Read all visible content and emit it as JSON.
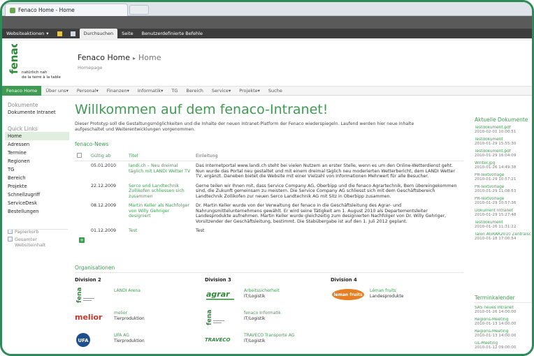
{
  "browser": {
    "tab_title": "Fenaco Home - Home"
  },
  "ribbon": {
    "site_actions": "Websiteaktionen",
    "tabs": [
      "Durchsuchen",
      "Seite",
      "Benutzerdefinierte Befehle"
    ]
  },
  "header": {
    "logo_text": "fenaco",
    "tagline_1": "natürlich nah",
    "tagline_2": "de la terre à la table",
    "site_title": "Fenaco Home",
    "breadcrumb_current": "Home",
    "subtitle": "Homepage"
  },
  "topnav": {
    "items": [
      {
        "label": "Fenaco Home",
        "selected": true,
        "dropdown": false
      },
      {
        "label": "Über uns",
        "dropdown": true
      },
      {
        "label": "Personal",
        "dropdown": true
      },
      {
        "label": "Finanzen",
        "dropdown": true
      },
      {
        "label": "Informatik",
        "dropdown": true
      },
      {
        "label": "TG",
        "dropdown": false
      },
      {
        "label": "Bereich",
        "dropdown": false
      },
      {
        "label": "Service",
        "dropdown": true
      },
      {
        "label": "Projekte",
        "dropdown": true
      },
      {
        "label": "Suche",
        "dropdown": false
      }
    ]
  },
  "quicklaunch": {
    "docs_header": "Dokumente",
    "docs_items": [
      "Dokumente Intranet"
    ],
    "links_header": "Quick Links",
    "links_items": [
      "Home",
      "Adressen",
      "Termine",
      "Regionen",
      "TG",
      "Bereich",
      "Projekte",
      "Schnellzugriff",
      "ServiceDesk",
      "Bestellungen"
    ],
    "selected": "Home",
    "recycle_bin": "Papierkorb",
    "all_content": "Gesamter Websiteinhalt"
  },
  "main": {
    "welcome": "Willkommen auf dem fenaco-Intranet!",
    "intro": "Dieser Prototyp soll die Gestaltungsmöglichkeiten und die Inhalte der neuen Intranet-Platform der Fenaco wiederspiegeln. Laufend werden hier neue Inhalte aufgeschaltet und Weiterentwicklungen vorgenommen.",
    "news_title": "fenaco-News",
    "news_columns": [
      "Gültig ab",
      "Titel",
      "Einleitung"
    ],
    "news_rows": [
      {
        "date": "05.01.2010",
        "title": "landi.ch – Neu dreimal täglich mit LANDI Wetter TV",
        "intro": "Das Internetportal www.landi.ch steht bei vielen Nutzern an erster Stelle, wenn es um den Online-Wetterdienst geht. Nun wurde das Portal neu gestaltet und mit einem dreimal täglich neu moderierten Wetterbericht, dem LANDI Wetter TV, ergänzt. Daneben bietet die Website mit einer Vielzahl von Informationen Mehrwert für alle Besucher."
      },
      {
        "date": "22.12.2009",
        "title": "Serco und Landtechnik Zollikofen schliessen sich zusammen",
        "intro": "Gerne teilen wir Ihnen mit, dass Service Company AG, Oberbipp und die fenaco Agrartechnik, Bern übereingekommen sind, die Zukunft gemeinsam zu meistern. Die Service Company AG schliesst sich mit dem Geschäftsbereich Landtechnik Zollikofen zur neuen Serco Landtechnik AG mit Sitz in Oberbipp zusammen."
      },
      {
        "date": "08.12.2009",
        "title": "Martin Keller als Nachfolger von Willy Gehriger designiert",
        "intro": "Dr. Martin Keller wurde von der Verwaltung der fenaco in die Geschäftsleitung des Agrar- und Nahrungsmittelunternehmens gewählt. Er wird seine Tätigkeit am 1. August 2010 als Departementsleiter Landesprodukte aufnehmen. Martin Keller wurde gleichzeitig zum designierten Nachfolger von Dr. Willy Gehriger, Vorsitzender der Geschäftsleitung, bestimmt. Die Stabübergabe ist auf den 1. Juli 2012 geplant."
      },
      {
        "date": "01.12.2009",
        "title": "Test",
        "intro": "Test"
      }
    ]
  },
  "orgs": {
    "title": "Organisationen",
    "divisions": [
      {
        "name": "Division 2",
        "items": [
          {
            "logo": "fenaco-logo",
            "name": "LANDI Arena",
            "dept": ""
          },
          {
            "logo": "melior-logo",
            "logo_text": "melior",
            "name": "melior",
            "dept": "Tierproduktion"
          },
          {
            "logo": "ufa-logo",
            "logo_text": "UFA",
            "name": "UFA AG",
            "dept": "Tierproduktion"
          }
        ]
      },
      {
        "name": "Division 3",
        "items": [
          {
            "logo": "agrar-logo",
            "logo_text": "agrar",
            "name": "Arbeitssicherheit",
            "dept": "IT/Logistik"
          },
          {
            "logo": "fenaco-logo",
            "name": "fenaco Informatik",
            "dept": "IT/Logistik"
          },
          {
            "logo": "traveco-logo",
            "logo_text": "TRAVECO",
            "name": "TRAVECO Transporte AG",
            "dept": "IT/Logistik"
          }
        ]
      },
      {
        "name": "Division 4",
        "items": [
          {
            "logo": "leman-logo",
            "logo_text": "leman fruits",
            "name": "Léman fruits",
            "dept": "Landesprodukte"
          }
        ]
      }
    ]
  },
  "right": {
    "docs_title": "Aktuelle Dokumente",
    "docs": [
      {
        "name": "Testdokument.pdf",
        "date": "2010-02-01 10:00:51"
      },
      {
        "name": "Testdokument",
        "date": "2010-01-29 15:55:30"
      },
      {
        "name": "Testdokument.pdf",
        "date": "2010-01-29 16:04:09"
      },
      {
        "name": "Winter.jpg",
        "date": "2010-01-26 14:49:38"
      },
      {
        "name": "PR-Textvorlage",
        "date": "2010-01-29 10:57:21"
      },
      {
        "name": "PR-Textvorlage",
        "date": "2010-01-29 11:08:53"
      },
      {
        "name": "PR-Textvorlage",
        "date": "2010-01-29 10:57:36"
      },
      {
        "name": "Dokument Intranet",
        "date": "2010-01-29 15:27:48"
      },
      {
        "name": "Testdokument",
        "date": "2010-01-26 11:31:22"
      },
      {
        "name": "Talon AGRAR2010 Zentralsc",
        "date": "2010-01-18 17:00:54"
      }
    ],
    "cal_title": "Terminkalender",
    "events": [
      {
        "name": "SAS neues Intranet",
        "date": "2010-01-26 14:00:00"
      },
      {
        "name": "Regions-Meeting",
        "date": "2010-01-13 14:00:00"
      },
      {
        "name": "Regions-Meeting",
        "date": "2010-01-13 14:00:00"
      },
      {
        "name": "GL-Meeting",
        "date": "2010-01-12 09:00:00"
      }
    ]
  },
  "colors": {
    "accent": "#3f9b52",
    "frame": "#2e8b57",
    "ribbon": "#3d3d3d"
  }
}
